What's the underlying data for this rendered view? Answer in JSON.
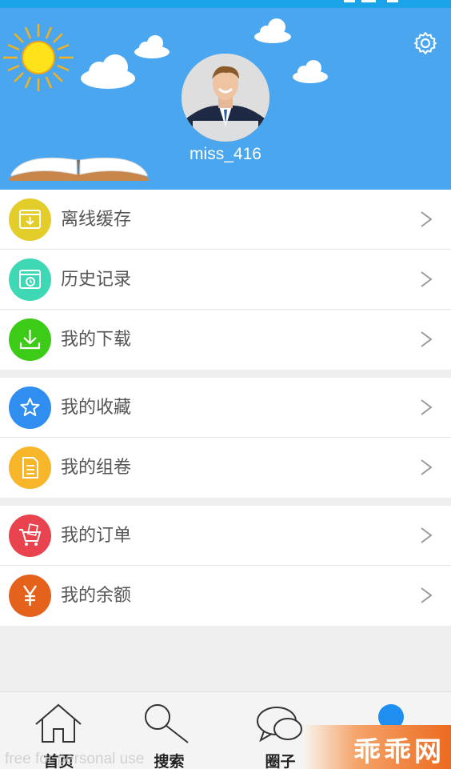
{
  "profile": {
    "username": "miss_416"
  },
  "menu_groups": [
    [
      {
        "label": "离线缓存",
        "icon": "offline-cache-icon",
        "color": "#e3cd2b"
      },
      {
        "label": "历史记录",
        "icon": "history-icon",
        "color": "#3ed9b4"
      },
      {
        "label": "我的下载",
        "icon": "download-icon",
        "color": "#3ccb17"
      }
    ],
    [
      {
        "label": "我的收藏",
        "icon": "star-icon",
        "color": "#2f8ef0"
      },
      {
        "label": "我的组卷",
        "icon": "document-icon",
        "color": "#f7b52a"
      }
    ],
    [
      {
        "label": "我的订单",
        "icon": "cart-icon",
        "color": "#e8434f"
      },
      {
        "label": "我的余额",
        "icon": "yen-icon",
        "color": "#e4621c"
      }
    ]
  ],
  "tabbar": {
    "tabs": [
      {
        "label": "首页",
        "icon": "home-icon"
      },
      {
        "label": "搜索",
        "icon": "search-icon"
      },
      {
        "label": "圈子",
        "icon": "chat-bubbles-icon"
      },
      {
        "label": "",
        "icon": "profile-dot-icon"
      }
    ]
  },
  "watermark": "free for personal use",
  "brand": "乖乖网",
  "colors": {
    "header_bg": "#4aa7ef",
    "status_bar": "#1aa3e8",
    "page_bg": "#efefef",
    "active_tab": "#1e8ff0"
  }
}
